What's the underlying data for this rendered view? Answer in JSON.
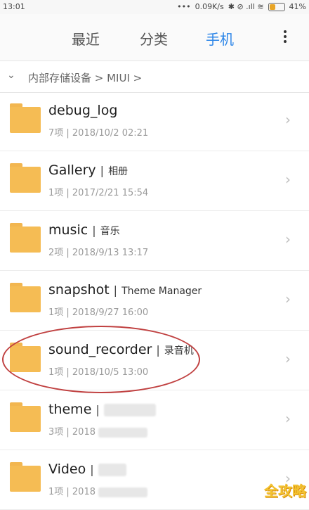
{
  "status": {
    "time": "13:01",
    "net_speed": "0.09K/s",
    "icons_text": "✱ ⊘ .ıll ≋",
    "battery_percent": "41%",
    "battery_level": 0.41
  },
  "tabs": [
    {
      "label": "最近",
      "active": false
    },
    {
      "label": "分类",
      "active": false
    },
    {
      "label": "手机",
      "active": true
    }
  ],
  "breadcrumb": {
    "chevron": "⌄",
    "path": "内部存储设备 > MIUI >"
  },
  "files": [
    {
      "name": "debug_log",
      "alias": "",
      "meta": "7项 | 2018/10/2 02:21"
    },
    {
      "name": "Gallery",
      "alias": "相册",
      "meta": "1项 | 2017/2/21 15:54"
    },
    {
      "name": "music",
      "alias": "音乐",
      "meta": "2项 | 2018/9/13 13:17"
    },
    {
      "name": "snapshot",
      "alias": "Theme Manager",
      "meta": "1项 | 2018/9/27 16:00"
    },
    {
      "name": "sound_recorder",
      "alias": "录音机",
      "meta": "1项 | 2018/10/5 13:00"
    },
    {
      "name": "theme",
      "alias": "",
      "meta": "3项 | 2018"
    },
    {
      "name": "Video",
      "alias": "",
      "meta": "1项 | 2018"
    }
  ],
  "watermark": "全攻略",
  "colors": {
    "accent": "#2d86e8",
    "folder": "#f5bc54",
    "highlight_circle": "#c04040"
  }
}
